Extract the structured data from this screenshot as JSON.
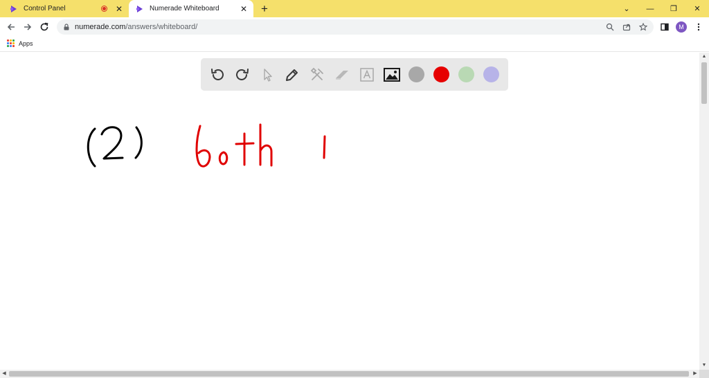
{
  "browser": {
    "tabs": [
      {
        "title": "Control Panel",
        "recording": true,
        "active": false
      },
      {
        "title": "Numerade Whiteboard",
        "active": true
      }
    ],
    "new_tab": "+",
    "window_controls": {
      "dropdown": "⌄",
      "minimize": "—",
      "restore": "❐",
      "close": "✕"
    },
    "url": {
      "host": "numerade.com",
      "path": "/answers/whiteboard/"
    },
    "profile_initial": "M",
    "bookmarks": [
      {
        "label": "Apps"
      }
    ]
  },
  "whiteboard": {
    "tools": [
      "undo-icon",
      "redo-icon",
      "pointer-icon",
      "pen-icon",
      "tools-icon",
      "eraser-icon",
      "text-icon",
      "image-icon"
    ],
    "colors": [
      "#a8a8a8",
      "#e60000",
      "#b9d9b4",
      "#b7b3e8"
    ],
    "ink_colors": {
      "black": "#000000",
      "red": "#e00000"
    }
  }
}
